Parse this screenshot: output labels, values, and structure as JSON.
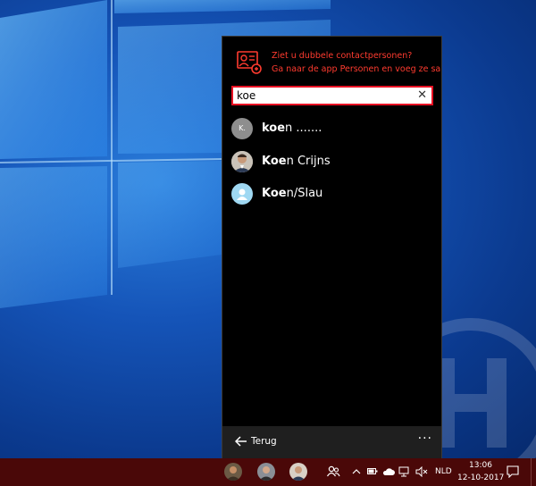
{
  "notice": {
    "line1": "Ziet u dubbele contactpersonen?",
    "line2": "Ga naar de app Personen en voeg ze samen",
    "icon": "people-merge-icon",
    "color": "#ff3b2f"
  },
  "search": {
    "value": "koe",
    "clear_glyph": "✕"
  },
  "results": [
    {
      "bold": "koe",
      "rest": "n .......",
      "initial": "K."
    },
    {
      "bold": "Koe",
      "rest": "n Crijns"
    },
    {
      "bold": "Koe",
      "rest": "n/Slau"
    }
  ],
  "footer": {
    "back_label": "Terug",
    "more_label": "···"
  },
  "taskbar": {
    "language": "NLD",
    "time": "13:06",
    "date": "12-10-2017",
    "color": "#4a0808"
  }
}
